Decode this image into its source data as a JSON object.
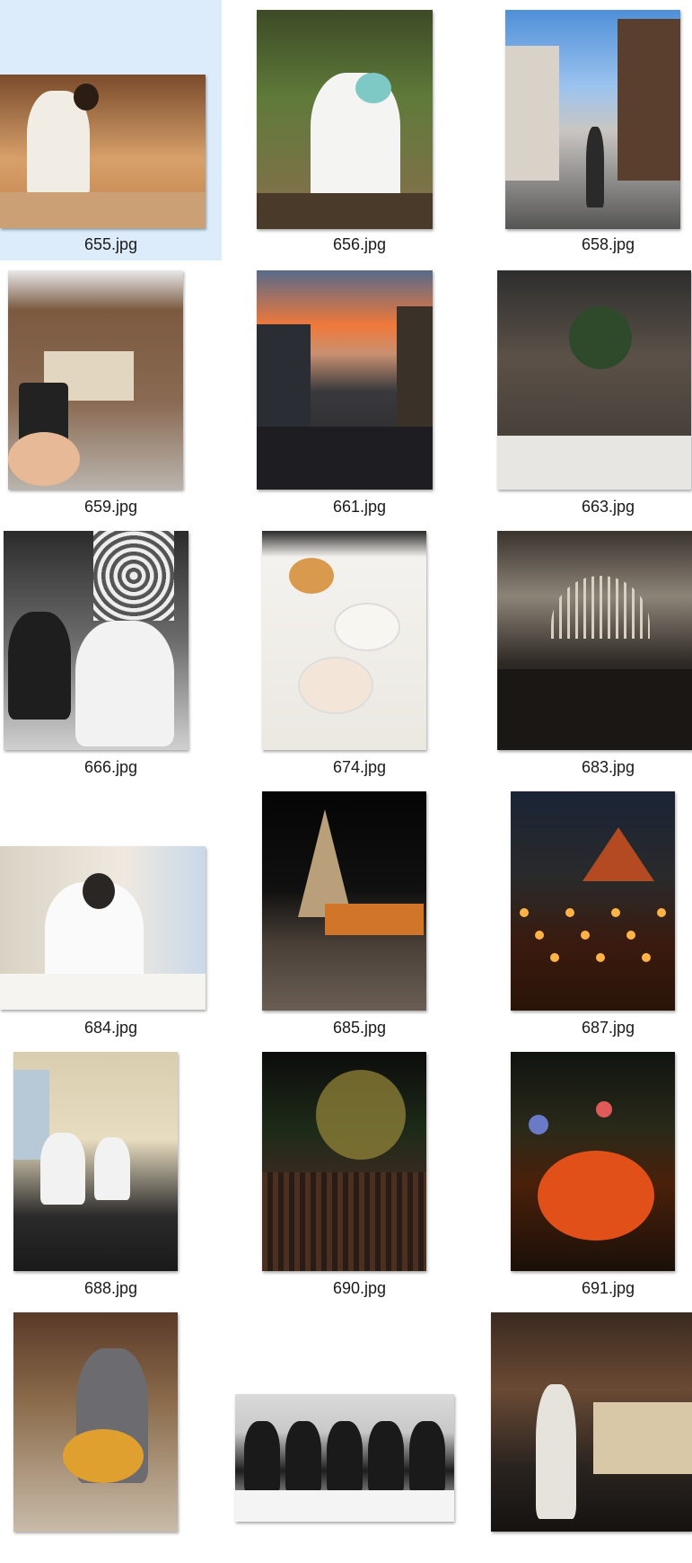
{
  "files": [
    {
      "name": "655.jpg",
      "selected": true,
      "scene": "chef-counter"
    },
    {
      "name": "656.jpg",
      "selected": false,
      "scene": "man-toasting-garden"
    },
    {
      "name": "658.jpg",
      "selected": false,
      "scene": "street-kyoto"
    },
    {
      "name": "659.jpg",
      "selected": false,
      "scene": "coffee-cup-storefront"
    },
    {
      "name": "661.jpg",
      "selected": false,
      "scene": "sunset-street-crowd"
    },
    {
      "name": "663.jpg",
      "selected": false,
      "scene": "restaurant-interior"
    },
    {
      "name": "666.jpg",
      "selected": false,
      "scene": "black-white-dining"
    },
    {
      "name": "674.jpg",
      "selected": false,
      "scene": "dim-sum-table"
    },
    {
      "name": "683.jpg",
      "selected": false,
      "scene": "dark-dining-hall"
    },
    {
      "name": "684.jpg",
      "selected": false,
      "scene": "man-window-city"
    },
    {
      "name": "685.jpg",
      "selected": false,
      "scene": "temple-monks-night"
    },
    {
      "name": "687.jpg",
      "selected": false,
      "scene": "temple-candles"
    },
    {
      "name": "688.jpg",
      "selected": false,
      "scene": "bartenders-room"
    },
    {
      "name": "690.jpg",
      "selected": false,
      "scene": "night-festival-crowd"
    },
    {
      "name": "691.jpg",
      "selected": false,
      "scene": "lantern-parade"
    },
    {
      "name": "",
      "selected": false,
      "scene": "woman-flower-tray"
    },
    {
      "name": "",
      "selected": false,
      "scene": "group-dinner"
    },
    {
      "name": "",
      "selected": false,
      "scene": "open-kitchen-chef"
    }
  ]
}
